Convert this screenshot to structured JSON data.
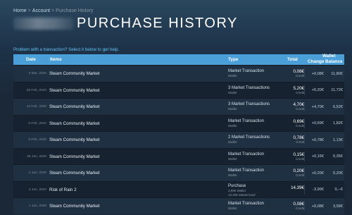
{
  "breadcrumb": {
    "home": "Home",
    "account": "Account",
    "current": "Purchase History",
    "sep": ">"
  },
  "title": "PURCHASE HISTORY",
  "help_text": "Problem with a transaction? Select it below to get help.",
  "columns": {
    "date": "Date",
    "items": "Items",
    "type": "Type",
    "total": "Total",
    "wallet": "Wallet",
    "change": "Change",
    "balance": "Balance"
  },
  "rows": [
    {
      "date": "5 Mar, 2020",
      "item": "Steam Community Market",
      "type": "Market Transaction",
      "type_sub": "Wallet",
      "total": "0,08€",
      "total_sub": "Credit",
      "change": "+0,08€",
      "balance": "11,80€"
    },
    {
      "date": "26 Feb, 2020",
      "item": "Steam Community Market",
      "type": "3 Market Transactions",
      "type_sub": "Wallet",
      "total": "5,20€",
      "total_sub": "Credit",
      "change": "+5,20€",
      "balance": "11,72€"
    },
    {
      "date": "24 Feb, 2020",
      "item": "Steam Community Market",
      "type": "3 Market Transactions",
      "type_sub": "Wallet",
      "total": "4,70€",
      "total_sub": "Credit",
      "change": "+4,70€",
      "balance": "6,52€"
    },
    {
      "date": "5 Feb, 2020",
      "item": "Steam Community Market",
      "type": "Market Transaction",
      "type_sub": "Wallet",
      "total": "0,69€",
      "total_sub": "Credit",
      "change": "+0,69€",
      "balance": "1,82€"
    },
    {
      "date": "3 Feb, 2020",
      "item": "Steam Community Market",
      "type": "2 Market Transactions",
      "type_sub": "Wallet",
      "total": "0,78€",
      "total_sub": "Credit",
      "change": "+0,78€",
      "balance": "1,13€"
    },
    {
      "date": "28 Jan, 2020",
      "item": "Steam Community Market",
      "type": "Market Transaction",
      "type_sub": "Wallet",
      "total": "0,15€",
      "total_sub": "Credit",
      "change": "+0,15€",
      "balance": "0,35€"
    },
    {
      "date": "2 Jan, 2020",
      "item": "Steam Community Market",
      "type": "Market Transaction",
      "type_sub": "Wallet",
      "total": "0,20€",
      "total_sub": "Credit",
      "change": "+0,20€",
      "balance": "0,20€"
    },
    {
      "date": "2 Jan, 2020",
      "item": "Risk of Rain 2",
      "type": "Purchase",
      "type_sub": "3,99€ Wallet",
      "type_sub2": "10,40€ MasterCard",
      "total": "14,39€",
      "total_sub": "",
      "change": "-3,99€",
      "balance": "0,--€"
    },
    {
      "date": "1 Jan, 2020",
      "item": "Steam Community Market",
      "type": "Market Transaction",
      "type_sub": "Wallet",
      "total": "0,08€",
      "total_sub": "Credit",
      "change": "+0,08€",
      "balance": "3,99€"
    }
  ]
}
